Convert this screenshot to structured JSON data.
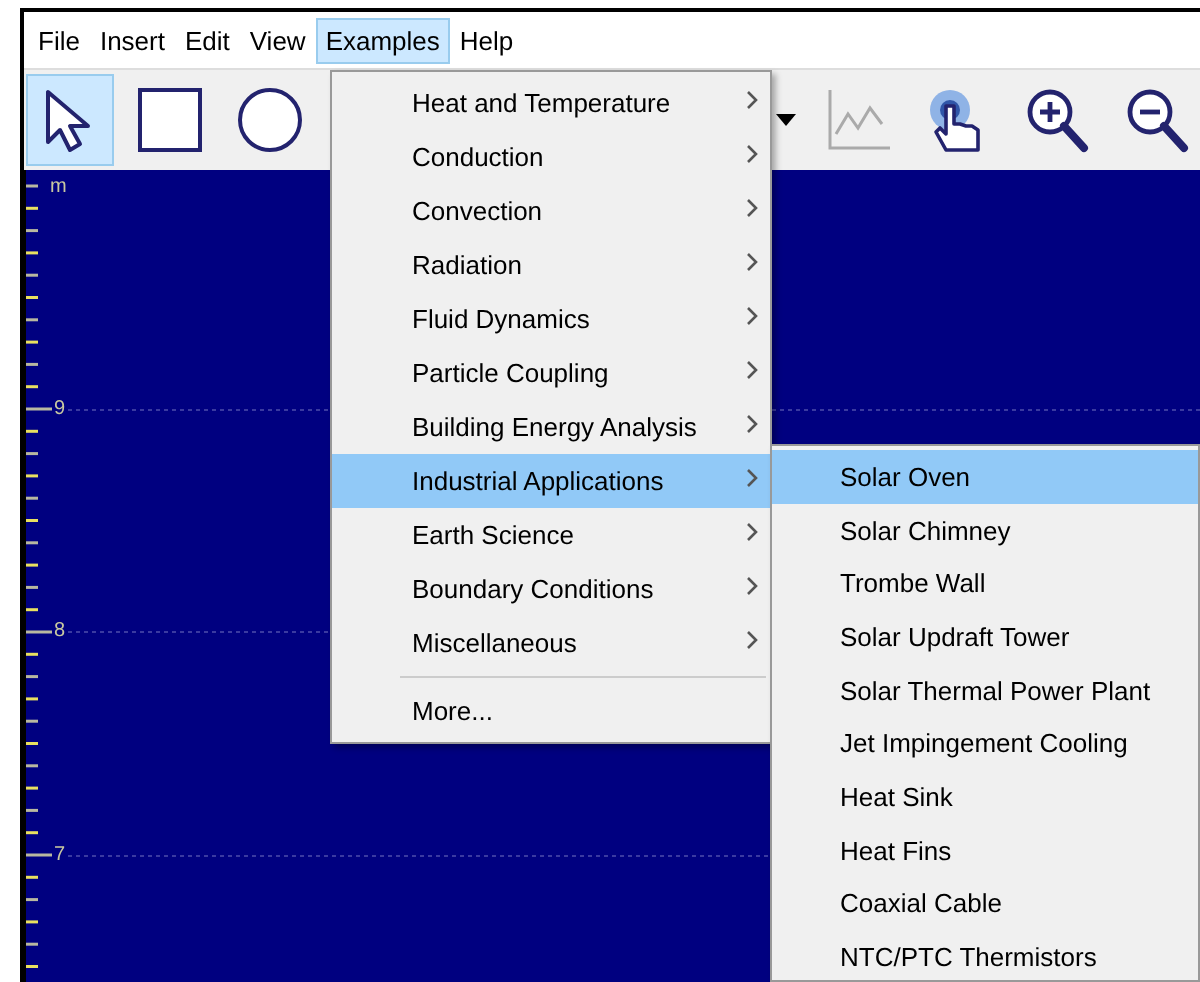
{
  "menubar": [
    {
      "label": "File",
      "selected": false
    },
    {
      "label": "Insert",
      "selected": false
    },
    {
      "label": "Edit",
      "selected": false
    },
    {
      "label": "View",
      "selected": false
    },
    {
      "label": "Examples",
      "selected": true
    },
    {
      "label": "Help",
      "selected": false
    }
  ],
  "toolbar": {
    "tools": [
      {
        "kind": "select",
        "selected": true
      },
      {
        "kind": "rectangle",
        "selected": false
      },
      {
        "kind": "ellipse",
        "selected": false
      },
      {
        "kind": "gap"
      },
      {
        "kind": "dropdown",
        "selected": false
      },
      {
        "kind": "graph",
        "selected": false
      },
      {
        "kind": "touch",
        "selected": false
      },
      {
        "kind": "zoom_in",
        "selected": false
      },
      {
        "kind": "zoom_out",
        "selected": false
      }
    ]
  },
  "canvas": {
    "ruler_unit": "m",
    "ruler_labels": [
      "9",
      "8",
      "7"
    ]
  },
  "examples_menu": [
    {
      "kind": "item",
      "label": "Heat and Temperature",
      "submenu": true,
      "selected": false
    },
    {
      "kind": "item",
      "label": "Conduction",
      "submenu": true,
      "selected": false
    },
    {
      "kind": "item",
      "label": "Convection",
      "submenu": true,
      "selected": false
    },
    {
      "kind": "item",
      "label": "Radiation",
      "submenu": true,
      "selected": false
    },
    {
      "kind": "item",
      "label": "Fluid Dynamics",
      "submenu": true,
      "selected": false
    },
    {
      "kind": "item",
      "label": "Particle Coupling",
      "submenu": true,
      "selected": false
    },
    {
      "kind": "item",
      "label": "Building Energy Analysis",
      "submenu": true,
      "selected": false
    },
    {
      "kind": "item",
      "label": "Industrial Applications",
      "submenu": true,
      "selected": true
    },
    {
      "kind": "item",
      "label": "Earth Science",
      "submenu": true,
      "selected": false
    },
    {
      "kind": "item",
      "label": "Boundary Conditions",
      "submenu": true,
      "selected": false
    },
    {
      "kind": "item",
      "label": "Miscellaneous",
      "submenu": true,
      "selected": false
    },
    {
      "kind": "separator"
    },
    {
      "kind": "item",
      "label": "More...",
      "submenu": false,
      "selected": false
    }
  ],
  "industrial_submenu": [
    {
      "label": "Solar Oven",
      "selected": true
    },
    {
      "label": "Solar Chimney",
      "selected": false
    },
    {
      "label": "Trombe Wall",
      "selected": false
    },
    {
      "label": "Solar Updraft Tower",
      "selected": false
    },
    {
      "label": "Solar Thermal Power Plant",
      "selected": false
    },
    {
      "label": "Jet Impingement Cooling",
      "selected": false
    },
    {
      "label": "Heat Sink",
      "selected": false
    },
    {
      "label": "Heat Fins",
      "selected": false
    },
    {
      "label": "Coaxial Cable",
      "selected": false
    },
    {
      "label": "NTC/PTC Thermistors",
      "selected": false
    }
  ]
}
